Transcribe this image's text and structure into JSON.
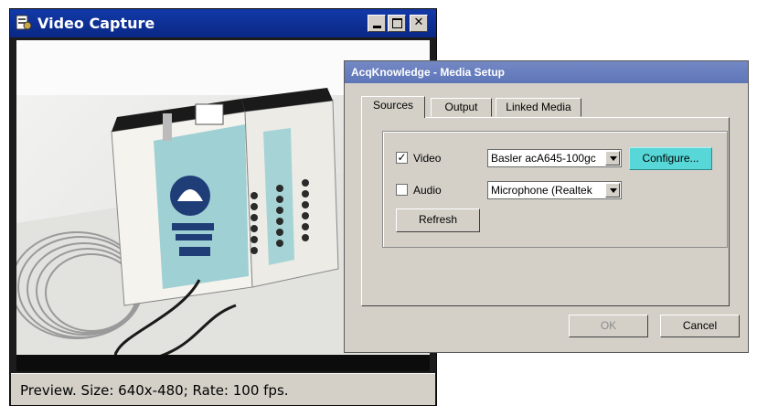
{
  "video_capture": {
    "title": "Video Capture",
    "status": "Preview. Size: 640x-480; Rate: 100 fps."
  },
  "media_setup": {
    "title": "AcqKnowledge - Media Setup",
    "tabs": [
      {
        "label": "Sources",
        "active": true
      },
      {
        "label": "Output",
        "active": false
      },
      {
        "label": "Linked Media",
        "active": false
      }
    ],
    "sources": {
      "video": {
        "label": "Video",
        "checked": true,
        "device": "Basler acA645-100gc"
      },
      "audio": {
        "label": "Audio",
        "checked": false,
        "device": "Microphone (Realtek"
      },
      "configure_label": "Configure...",
      "refresh_label": "Refresh"
    },
    "ok_label": "OK",
    "cancel_label": "Cancel"
  },
  "colors": {
    "titlebar_active": "#0b2a8e",
    "titlebar_inactive": "#6a80be",
    "configure_highlight": "#57d7d7"
  }
}
